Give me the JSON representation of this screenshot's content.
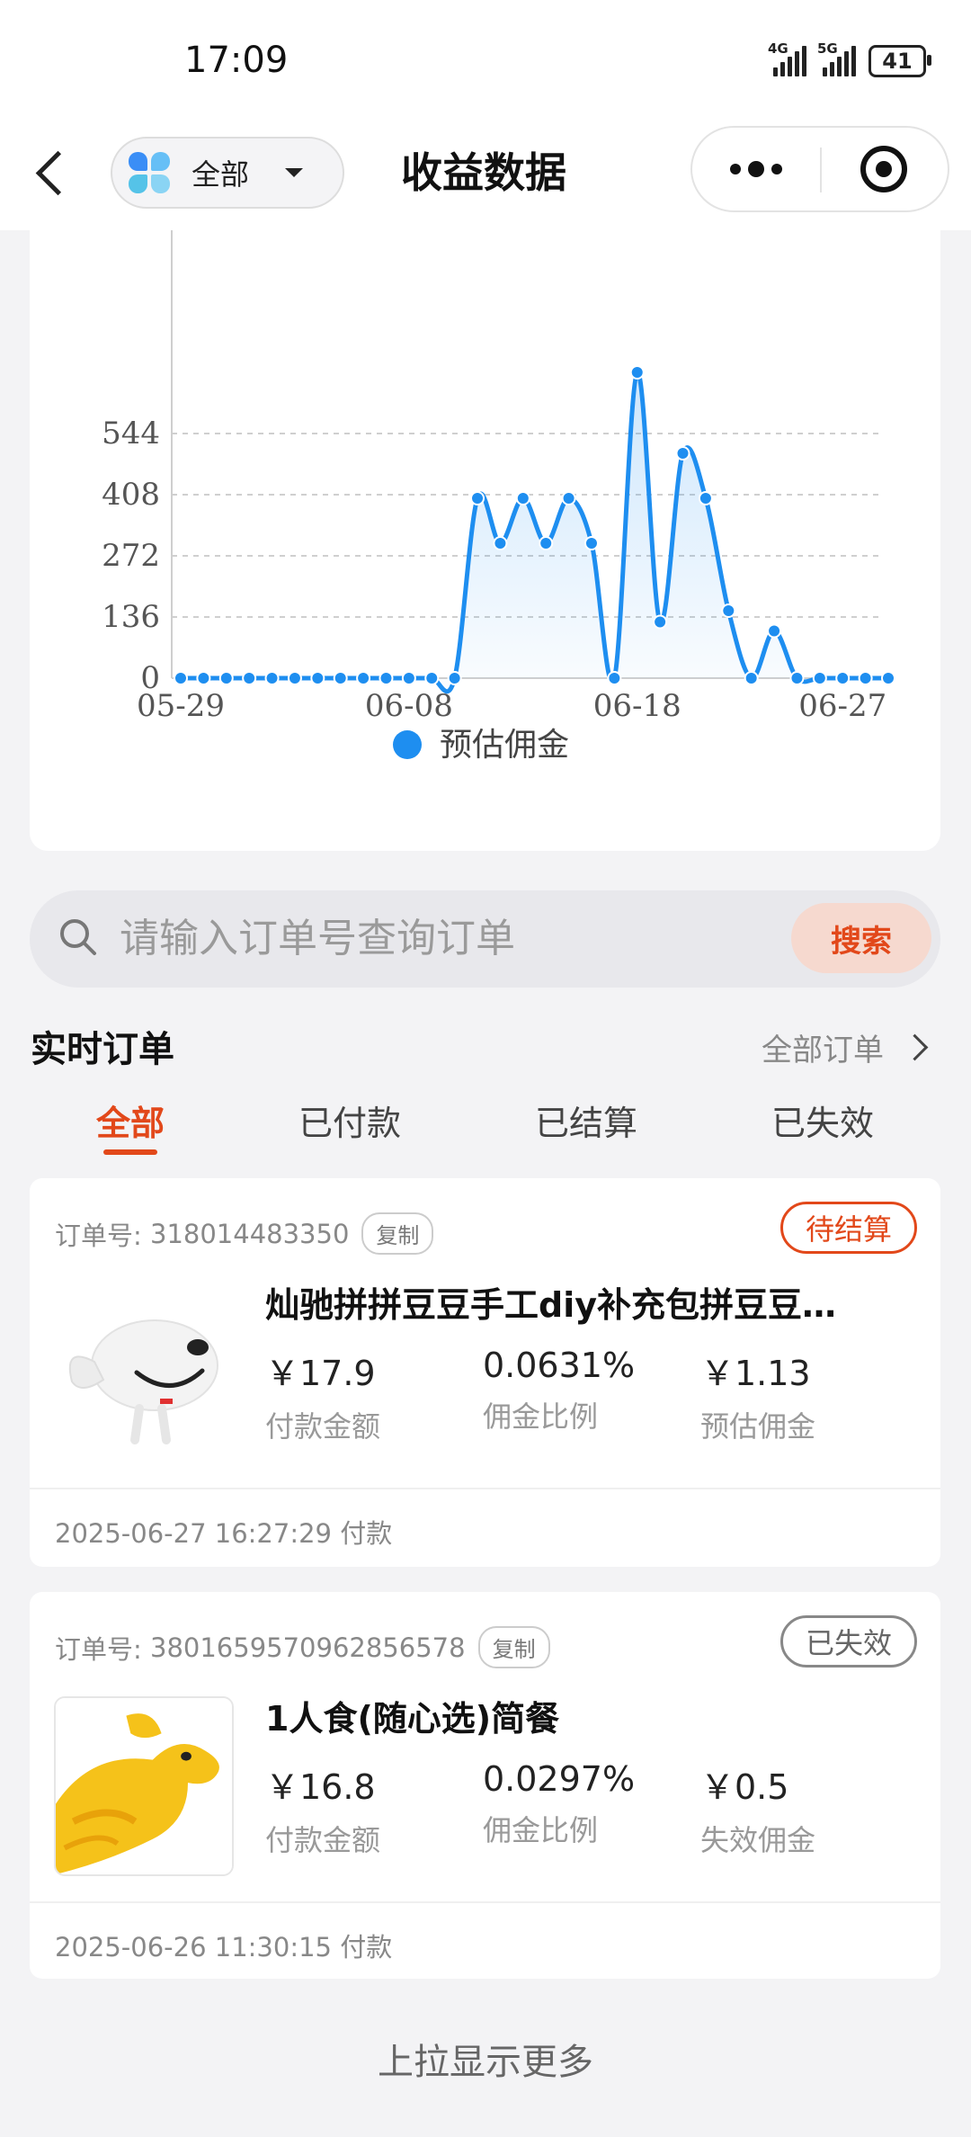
{
  "status_bar": {
    "time": "17:09",
    "signal_1": "4G",
    "signal_2": "5G",
    "battery": "41"
  },
  "nav": {
    "filter_label": "全部",
    "title": "收益数据"
  },
  "chart_data": {
    "type": "area",
    "x_ticks": [
      "05-29",
      "06-08",
      "06-18",
      "06-27"
    ],
    "y_ticks": [
      "0",
      "136",
      "272",
      "408",
      "544"
    ],
    "ylim": [
      0,
      680
    ],
    "grid": true,
    "legend_position": "bottom",
    "legend_color": "#1e8ef0",
    "series": [
      {
        "name": "预估佣金",
        "x": [
          "05-29",
          "05-30",
          "05-31",
          "06-01",
          "06-02",
          "06-03",
          "06-04",
          "06-05",
          "06-06",
          "06-07",
          "06-08",
          "06-09",
          "06-10",
          "06-11",
          "06-12",
          "06-13",
          "06-14",
          "06-15",
          "06-16",
          "06-17",
          "06-18",
          "06-19",
          "06-20",
          "06-21",
          "06-22",
          "06-23",
          "06-24",
          "06-25",
          "06-26",
          "06-27",
          "06-28",
          "06-29"
        ],
        "values": [
          0,
          0,
          0,
          0,
          0,
          0,
          0,
          0,
          0,
          0,
          0,
          0,
          0,
          400,
          300,
          400,
          300,
          400,
          300,
          0,
          680,
          125,
          500,
          400,
          150,
          0,
          105,
          0,
          0,
          0,
          0,
          0
        ]
      }
    ]
  },
  "search": {
    "placeholder": "请输入订单号查询订单",
    "button": "搜索"
  },
  "section": {
    "title": "实时订单",
    "all_orders": "全部订单"
  },
  "tabs": [
    "全部",
    "已付款",
    "已结算",
    "已失效"
  ],
  "orders": [
    {
      "order_label": "订单号:",
      "order_no": "318014483350",
      "copy": "复制",
      "status": "待结算",
      "title": "灿驰拼拼豆豆手工diy补充包拼豆豆…",
      "pay_amount": "￥17.9",
      "pay_amount_label": "付款金额",
      "rate": "0.0631%",
      "rate_label": "佣金比例",
      "commission": "￥1.13",
      "commission_label": "预估佣金",
      "time": "2025-06-27 16:27:29 付款"
    },
    {
      "order_label": "订单号:",
      "order_no": "3801659570962856578",
      "copy": "复制",
      "status": "已失效",
      "title": "1人食(随心选)简餐",
      "pay_amount": "￥16.8",
      "pay_amount_label": "付款金额",
      "rate": "0.0297%",
      "rate_label": "佣金比例",
      "commission": "￥0.5",
      "commission_label": "失效佣金",
      "time": "2025-06-26 11:30:15 付款"
    }
  ],
  "footer": {
    "load_more": "上拉显示更多"
  }
}
